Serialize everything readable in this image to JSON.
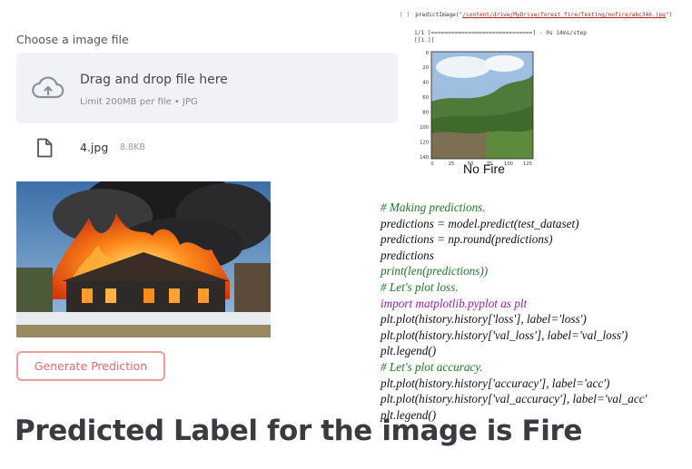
{
  "uploader": {
    "label": "Choose a image file",
    "dropzone_title": "Drag and drop file here",
    "dropzone_sub": "Limit 200MB per file • JPG",
    "icon": "cloud-upload-icon"
  },
  "file": {
    "name": "4.jpg",
    "size": "8.8KB",
    "icon": "file-icon"
  },
  "image": {
    "description_icon": "house-fire-photo"
  },
  "button": {
    "label": "Generate Prediction",
    "color": "#e86a6a"
  },
  "result": {
    "headline": "Predicted Label for the image is Fire"
  },
  "notebook": {
    "cell_index": "[ ]",
    "call_prefix": "predictImage(\"",
    "call_path": "/content/drive/MyDrive/forest_fire/Testing/nofire/abc346.jpg",
    "call_suffix": "\")",
    "progress_line": "1/1 [==============================] - 0s 14ms/step",
    "output_array": "[[1.]]",
    "plot_title": "No Fire",
    "y_ticks": [
      "0",
      "20",
      "40",
      "60",
      "80",
      "100",
      "120",
      "140"
    ],
    "x_ticks": [
      "0",
      "25",
      "50",
      "75",
      "100",
      "125"
    ]
  },
  "code": {
    "lines": [
      "# Making predictions.",
      "predictions = model.predict(test_dataset)",
      "predictions = np.round(predictions)",
      "predictions",
      "print(len(predictions))",
      "# Let's plot loss.",
      "import matplotlib.pyplot as plt",
      "plt.plot(history.history['loss'], label='loss')",
      "plt.plot(history.history['val_loss'], label='val_loss')",
      "plt.legend()",
      "# Let's plot accuracy.",
      "plt.plot(history.history['accuracy'], label='acc')",
      "plt.plot(history.history['val_accuracy'], label='val_acc'",
      "plt.legend()"
    ]
  }
}
